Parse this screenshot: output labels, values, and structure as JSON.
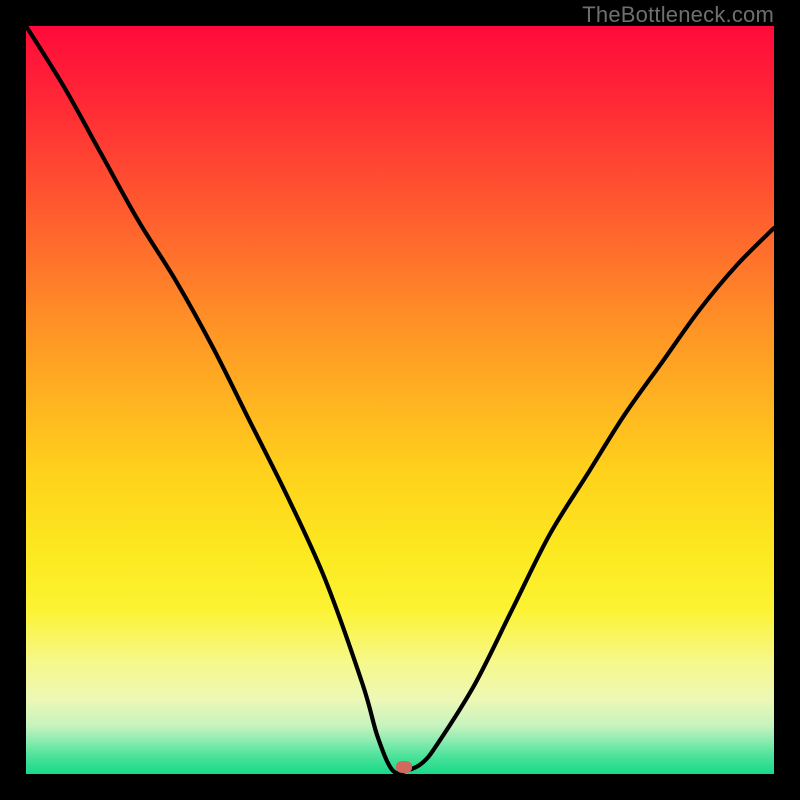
{
  "watermark": "TheBottleneck.com",
  "chart_data": {
    "type": "line",
    "title": "",
    "xlabel": "",
    "ylabel": "",
    "xlim": [
      0,
      100
    ],
    "ylim": [
      0,
      100
    ],
    "grid": false,
    "legend": false,
    "series": [
      {
        "name": "bottleneck-curve",
        "x": [
          0,
          5,
          10,
          15,
          20,
          25,
          30,
          35,
          40,
          45,
          47,
          49,
          51,
          53,
          55,
          60,
          65,
          70,
          75,
          80,
          85,
          90,
          95,
          100
        ],
        "values": [
          100,
          92,
          83,
          74,
          66,
          57,
          47,
          37,
          26,
          12,
          5,
          0.5,
          0.5,
          1.5,
          4,
          12,
          22,
          32,
          40,
          48,
          55,
          62,
          68,
          73
        ]
      }
    ],
    "optimum_marker": {
      "x": 50.5,
      "y": 0.9,
      "color": "#cf6a5d"
    },
    "gradient_stops": [
      {
        "offset": 0,
        "color": "#ff0a3a"
      },
      {
        "offset": 0.1,
        "color": "#ff2836"
      },
      {
        "offset": 0.2,
        "color": "#ff4b31"
      },
      {
        "offset": 0.3,
        "color": "#ff6e2c"
      },
      {
        "offset": 0.4,
        "color": "#ff9226"
      },
      {
        "offset": 0.5,
        "color": "#ffb321"
      },
      {
        "offset": 0.6,
        "color": "#ffd21c"
      },
      {
        "offset": 0.7,
        "color": "#fce81f"
      },
      {
        "offset": 0.78,
        "color": "#fcf333"
      },
      {
        "offset": 0.85,
        "color": "#f6f88a"
      },
      {
        "offset": 0.9,
        "color": "#edf8b5"
      },
      {
        "offset": 0.935,
        "color": "#c7f3bf"
      },
      {
        "offset": 0.955,
        "color": "#8eecb0"
      },
      {
        "offset": 0.975,
        "color": "#4fe39c"
      },
      {
        "offset": 1.0,
        "color": "#17d987"
      }
    ]
  }
}
